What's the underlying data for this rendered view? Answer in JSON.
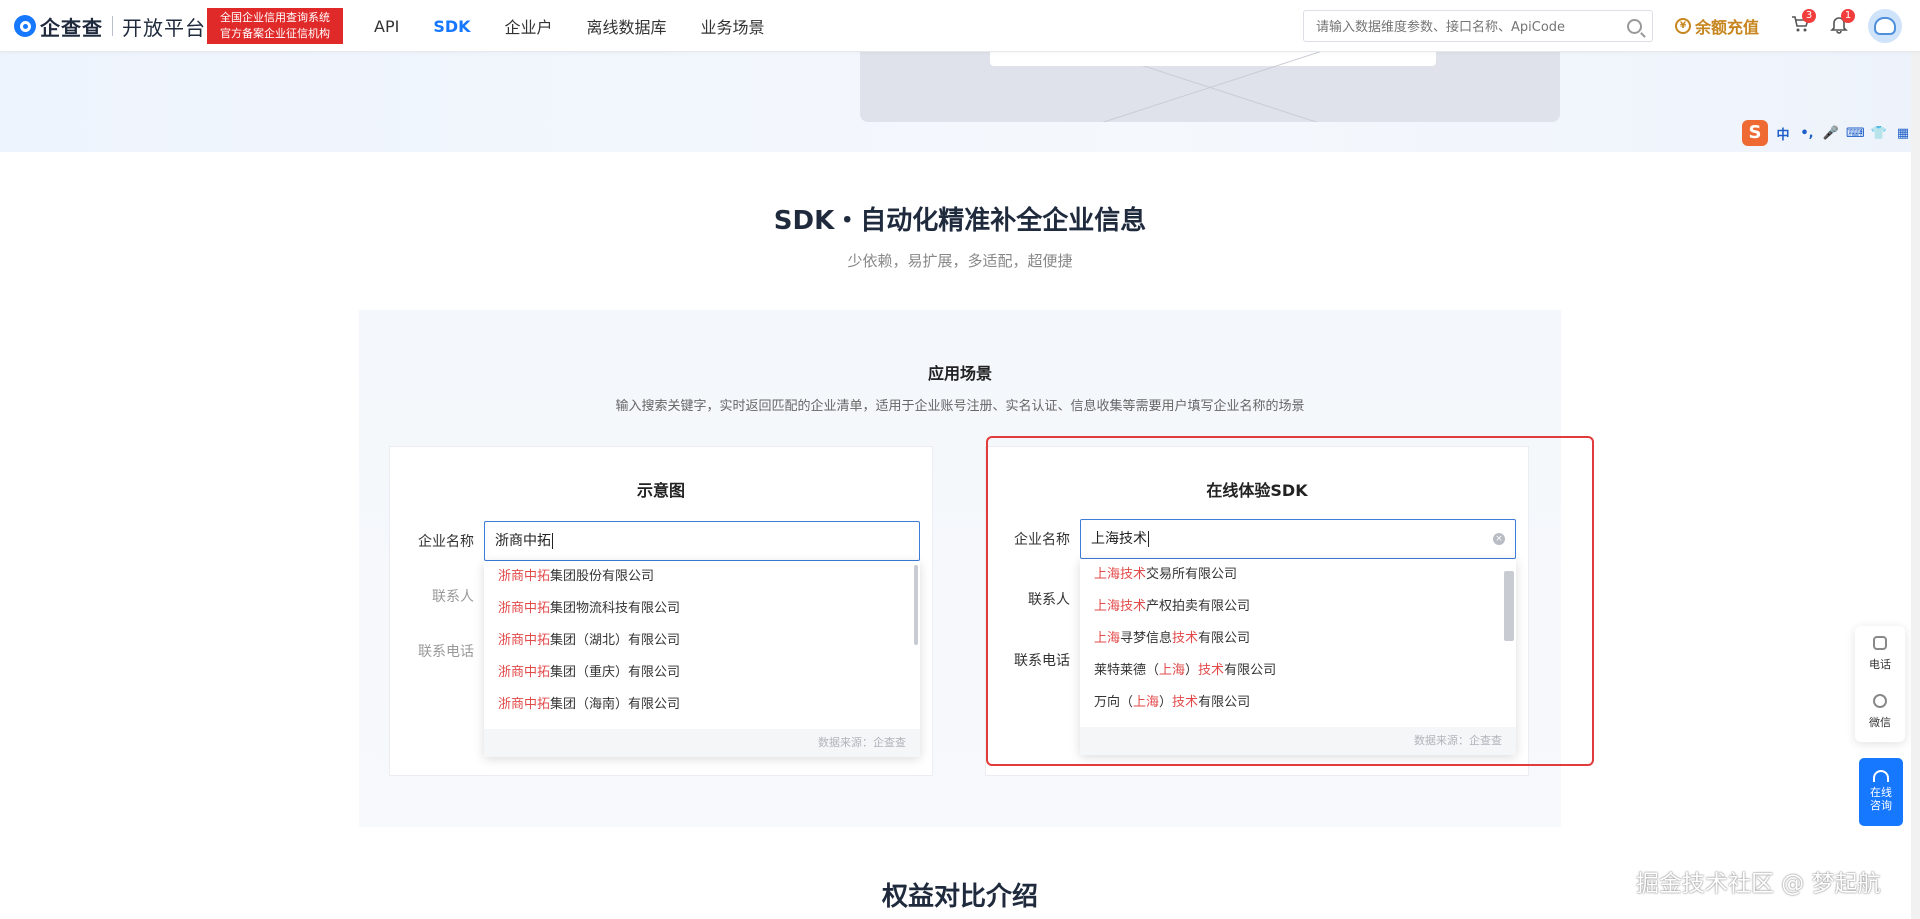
{
  "header": {
    "logo_name": "企查查",
    "logo_sub": "开放平台",
    "badge_line1": "全国企业信用查询系统",
    "badge_line2": "官方备案企业征信机构",
    "nav": [
      {
        "label": "API",
        "active": false
      },
      {
        "label": "SDK",
        "active": true
      },
      {
        "label": "企业户",
        "active": false
      },
      {
        "label": "离线数据库",
        "active": false
      },
      {
        "label": "业务场景",
        "active": false
      }
    ],
    "search_placeholder": "请输入数据维度参数、接口名称、ApiCode",
    "recharge_label": "余额充值",
    "coin_glyph": "¥",
    "cart_count": "3",
    "bell_count": "1"
  },
  "ime": {
    "logo": "S",
    "items": [
      "中",
      "•,",
      "🎤",
      "⌨",
      "👕",
      "▦"
    ]
  },
  "section": {
    "title": "SDK・自动化精准补全企业信息",
    "subtitle": "少依赖，易扩展，多适配，超便捷"
  },
  "panel": {
    "title": "应用场景",
    "desc": "输入搜索关键字，实时返回匹配的企业清单，适用于企业账号注册、实名认证、信息收集等需要用户填写企业名称的场景"
  },
  "demo_left": {
    "title": "示意图",
    "label_company": "企业名称",
    "label_contact": "联系人",
    "label_phone": "联系电话",
    "input_value": "浙商中拓",
    "suggestions": [
      {
        "hl": "浙商中拓",
        "rest": "集团股份有限公司"
      },
      {
        "hl": "浙商中拓",
        "rest": "集团物流科技有限公司"
      },
      {
        "hl": "浙商中拓",
        "rest": "集团（湖北）有限公司"
      },
      {
        "hl": "浙商中拓",
        "rest": "集团（重庆）有限公司"
      },
      {
        "hl": "浙商中拓",
        "rest": "集团（海南）有限公司"
      }
    ],
    "footer": "数据来源：企查查"
  },
  "demo_right": {
    "title": "在线体验SDK",
    "label_company": "企业名称",
    "label_contact": "联系人",
    "label_phone": "联系电话",
    "input_value": "上海技术",
    "clear_glyph": "×",
    "suggestions": [
      [
        {
          "t": "上海技术",
          "h": true
        },
        {
          "t": "交易所有限公司",
          "h": false
        }
      ],
      [
        {
          "t": "上海技术",
          "h": true
        },
        {
          "t": "产权拍卖有限公司",
          "h": false
        }
      ],
      [
        {
          "t": "上海",
          "h": true
        },
        {
          "t": "寻梦信息",
          "h": false
        },
        {
          "t": "技术",
          "h": true
        },
        {
          "t": "有限公司",
          "h": false
        }
      ],
      [
        {
          "t": "莱特莱德（",
          "h": false
        },
        {
          "t": "上海",
          "h": true
        },
        {
          "t": "）",
          "h": false
        },
        {
          "t": "技术",
          "h": true
        },
        {
          "t": "有限公司",
          "h": false
        }
      ],
      [
        {
          "t": "万向（",
          "h": false
        },
        {
          "t": "上海",
          "h": true
        },
        {
          "t": "）",
          "h": false
        },
        {
          "t": "技术",
          "h": true
        },
        {
          "t": "有限公司",
          "h": false
        }
      ]
    ],
    "footer": "数据来源：企查查"
  },
  "float": {
    "phone": "电话",
    "wechat": "微信",
    "online_line1": "在线",
    "online_line2": "咨询"
  },
  "bottom": {
    "title": "权益对比介绍",
    "watermark": "掘金技术社区 @ 梦起航"
  },
  "colors": {
    "accent": "#1677ff",
    "highlight": "#e24a4a",
    "frame": "#e23b3b"
  }
}
